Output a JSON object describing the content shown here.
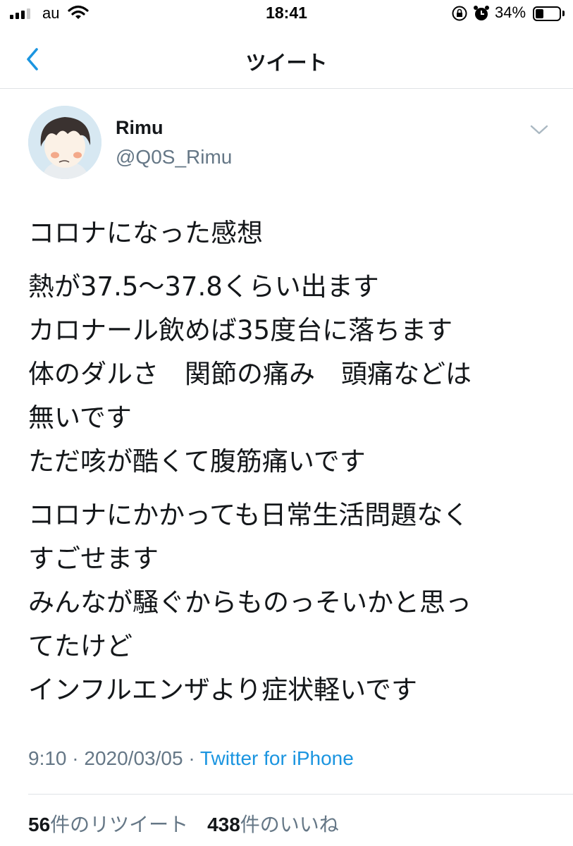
{
  "status_bar": {
    "carrier": "au",
    "time": "18:41",
    "battery_percent": "34%",
    "battery_level": 0.34,
    "icons": [
      "signal-icon",
      "wifi-icon",
      "orientation-lock-icon",
      "alarm-icon",
      "battery-icon"
    ]
  },
  "nav": {
    "back_icon": "chevron-left-icon",
    "title": "ツイート"
  },
  "tweet": {
    "author": {
      "display_name": "Rimu",
      "handle": "@Q0S_Rimu"
    },
    "body_paragraphs": [
      [
        "コロナになった感想"
      ],
      [
        "熱が37.5〜37.8くらい出ます",
        "カロナール飲めば35度台に落ちます",
        "体のダルさ　関節の痛み　頭痛などは",
        "無いです",
        "ただ咳が酷くて腹筋痛いです"
      ],
      [
        "コロナにかかっても日常生活問題なく",
        "すごせます",
        "みんなが騒ぐからものっそいかと思っ",
        "てたけど",
        "インフルエンザより症状軽いです"
      ]
    ],
    "time": "9:10",
    "separator": "·",
    "date": "2020/03/05",
    "source": "Twitter for iPhone",
    "stats": {
      "retweet_count": "56",
      "retweet_label": "件のリツイート",
      "like_count": "438",
      "like_label": "件のいいね"
    }
  },
  "colors": {
    "link_blue": "#1b95e0",
    "secondary_gray": "#657786",
    "text_dark": "#14171a",
    "divider": "#dfe3e6"
  }
}
